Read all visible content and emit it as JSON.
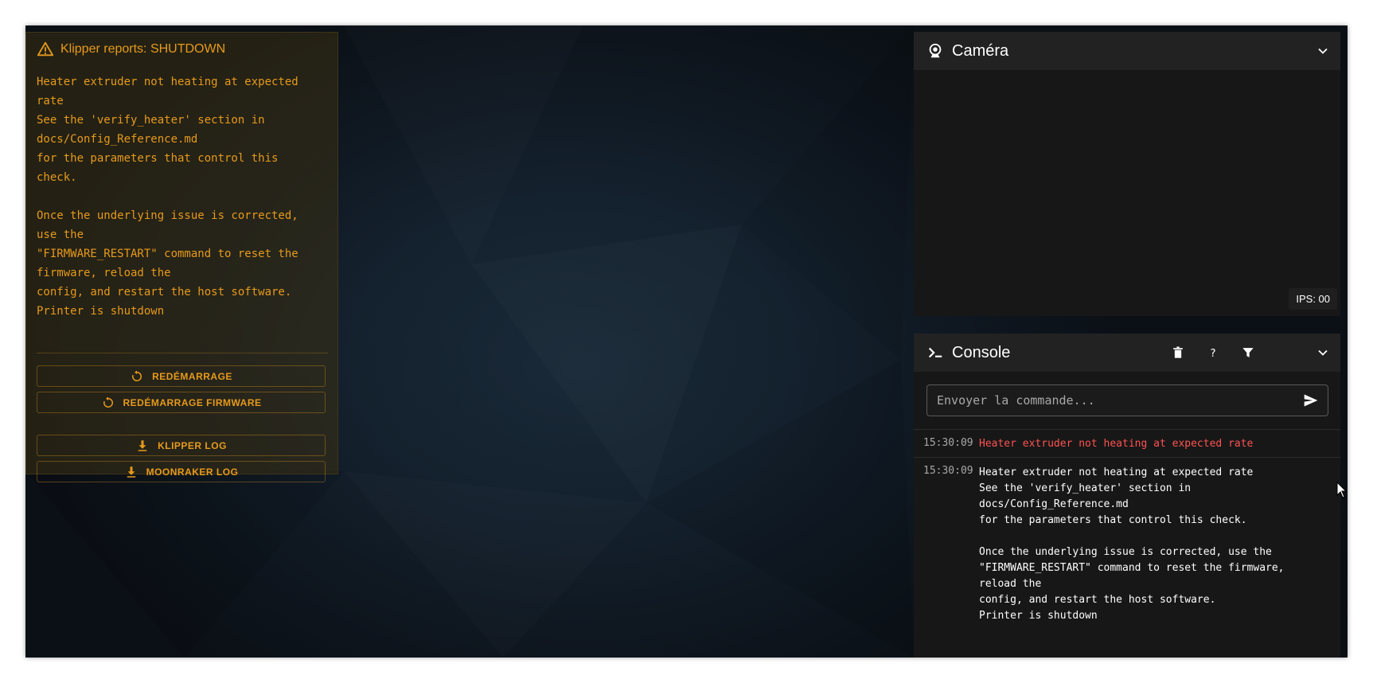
{
  "shutdown": {
    "title": "Klipper reports: SHUTDOWN",
    "message": "Heater extruder not heating at expected\nrate\nSee the 'verify_heater' section in\ndocs/Config_Reference.md\nfor the parameters that control this\ncheck.\n\nOnce the underlying issue is corrected,\nuse the\n\"FIRMWARE_RESTART\" command to reset the\nfirmware, reload the\nconfig, and restart the host software.\nPrinter is shutdown",
    "buttons": {
      "restart": "REDÉMARRAGE",
      "firmware_restart": "REDÉMARRAGE FIRMWARE",
      "klipper_log": "KLIPPER LOG",
      "moonraker_log": "MOONRAKER LOG"
    },
    "accent_color": "#e69a1c"
  },
  "camera": {
    "title": "Caméra",
    "fps": "IPS: 00"
  },
  "console": {
    "title": "Console",
    "input_placeholder": "Envoyer la commande...",
    "error_color": "#ff5252",
    "entries": [
      {
        "time": "15:30:09",
        "message": "Heater extruder not heating at expected rate",
        "level": "error"
      },
      {
        "time": "15:30:09",
        "message": "Heater extruder not heating at expected rate\nSee the 'verify_heater' section in\ndocs/Config_Reference.md\nfor the parameters that control this check.\n\nOnce the underlying issue is corrected, use the\n\"FIRMWARE_RESTART\" command to reset the firmware,\nreload the\nconfig, and restart the host software.\nPrinter is shutdown",
        "level": "info"
      }
    ]
  },
  "icons": [
    "alert-icon",
    "restart-icon",
    "download-icon",
    "webcam-icon",
    "console-icon",
    "trash-icon",
    "help-icon",
    "filter-icon",
    "chevron-down-icon",
    "send-icon",
    "mouse-cursor-icon"
  ]
}
